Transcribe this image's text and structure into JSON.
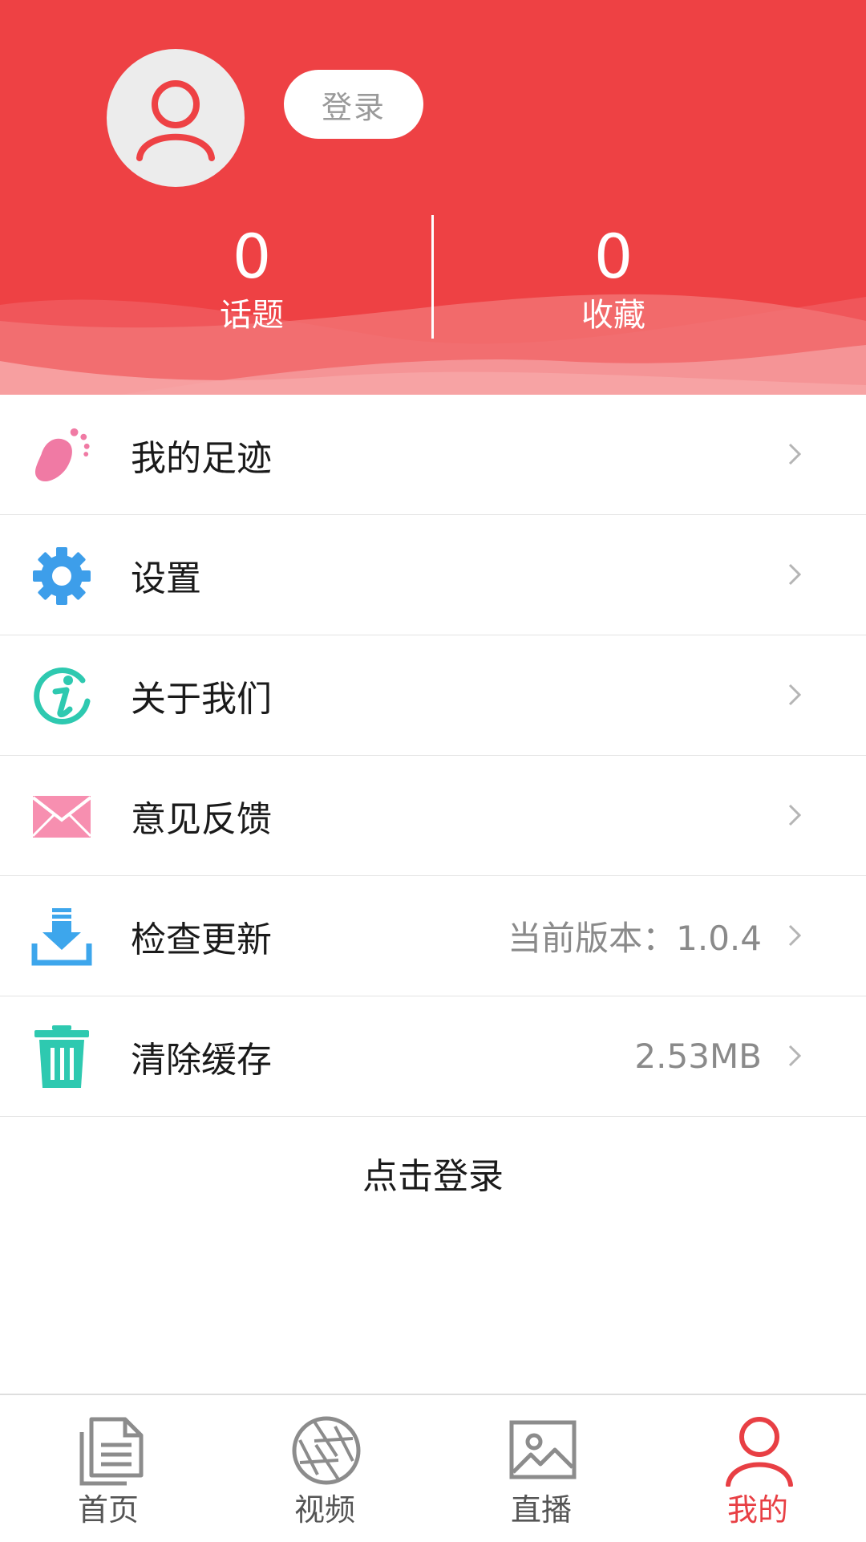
{
  "header": {
    "login_label": "登录",
    "stats": [
      {
        "value": "0",
        "label": "话题"
      },
      {
        "value": "0",
        "label": "收藏"
      }
    ],
    "bg_color": "#ee4144"
  },
  "menu": {
    "items": [
      {
        "label": "我的足迹",
        "value": "",
        "icon": "footprint-icon"
      },
      {
        "label": "设置",
        "value": "",
        "icon": "gear-icon"
      },
      {
        "label": "关于我们",
        "value": "",
        "icon": "info-icon"
      },
      {
        "label": "意见反馈",
        "value": "",
        "icon": "envelope-icon"
      },
      {
        "label": "检查更新",
        "value": "当前版本：1.0.4",
        "icon": "download-icon"
      },
      {
        "label": "清除缓存",
        "value": "2.53MB",
        "icon": "trash-icon"
      }
    ]
  },
  "click_login": "点击登录",
  "bottom_nav": {
    "items": [
      {
        "label": "首页",
        "icon": "document-icon",
        "active": false
      },
      {
        "label": "视频",
        "icon": "aperture-icon",
        "active": false
      },
      {
        "label": "直播",
        "icon": "image-icon",
        "active": false
      },
      {
        "label": "我的",
        "icon": "user-icon",
        "active": true
      }
    ],
    "active_color": "#e83f44"
  }
}
